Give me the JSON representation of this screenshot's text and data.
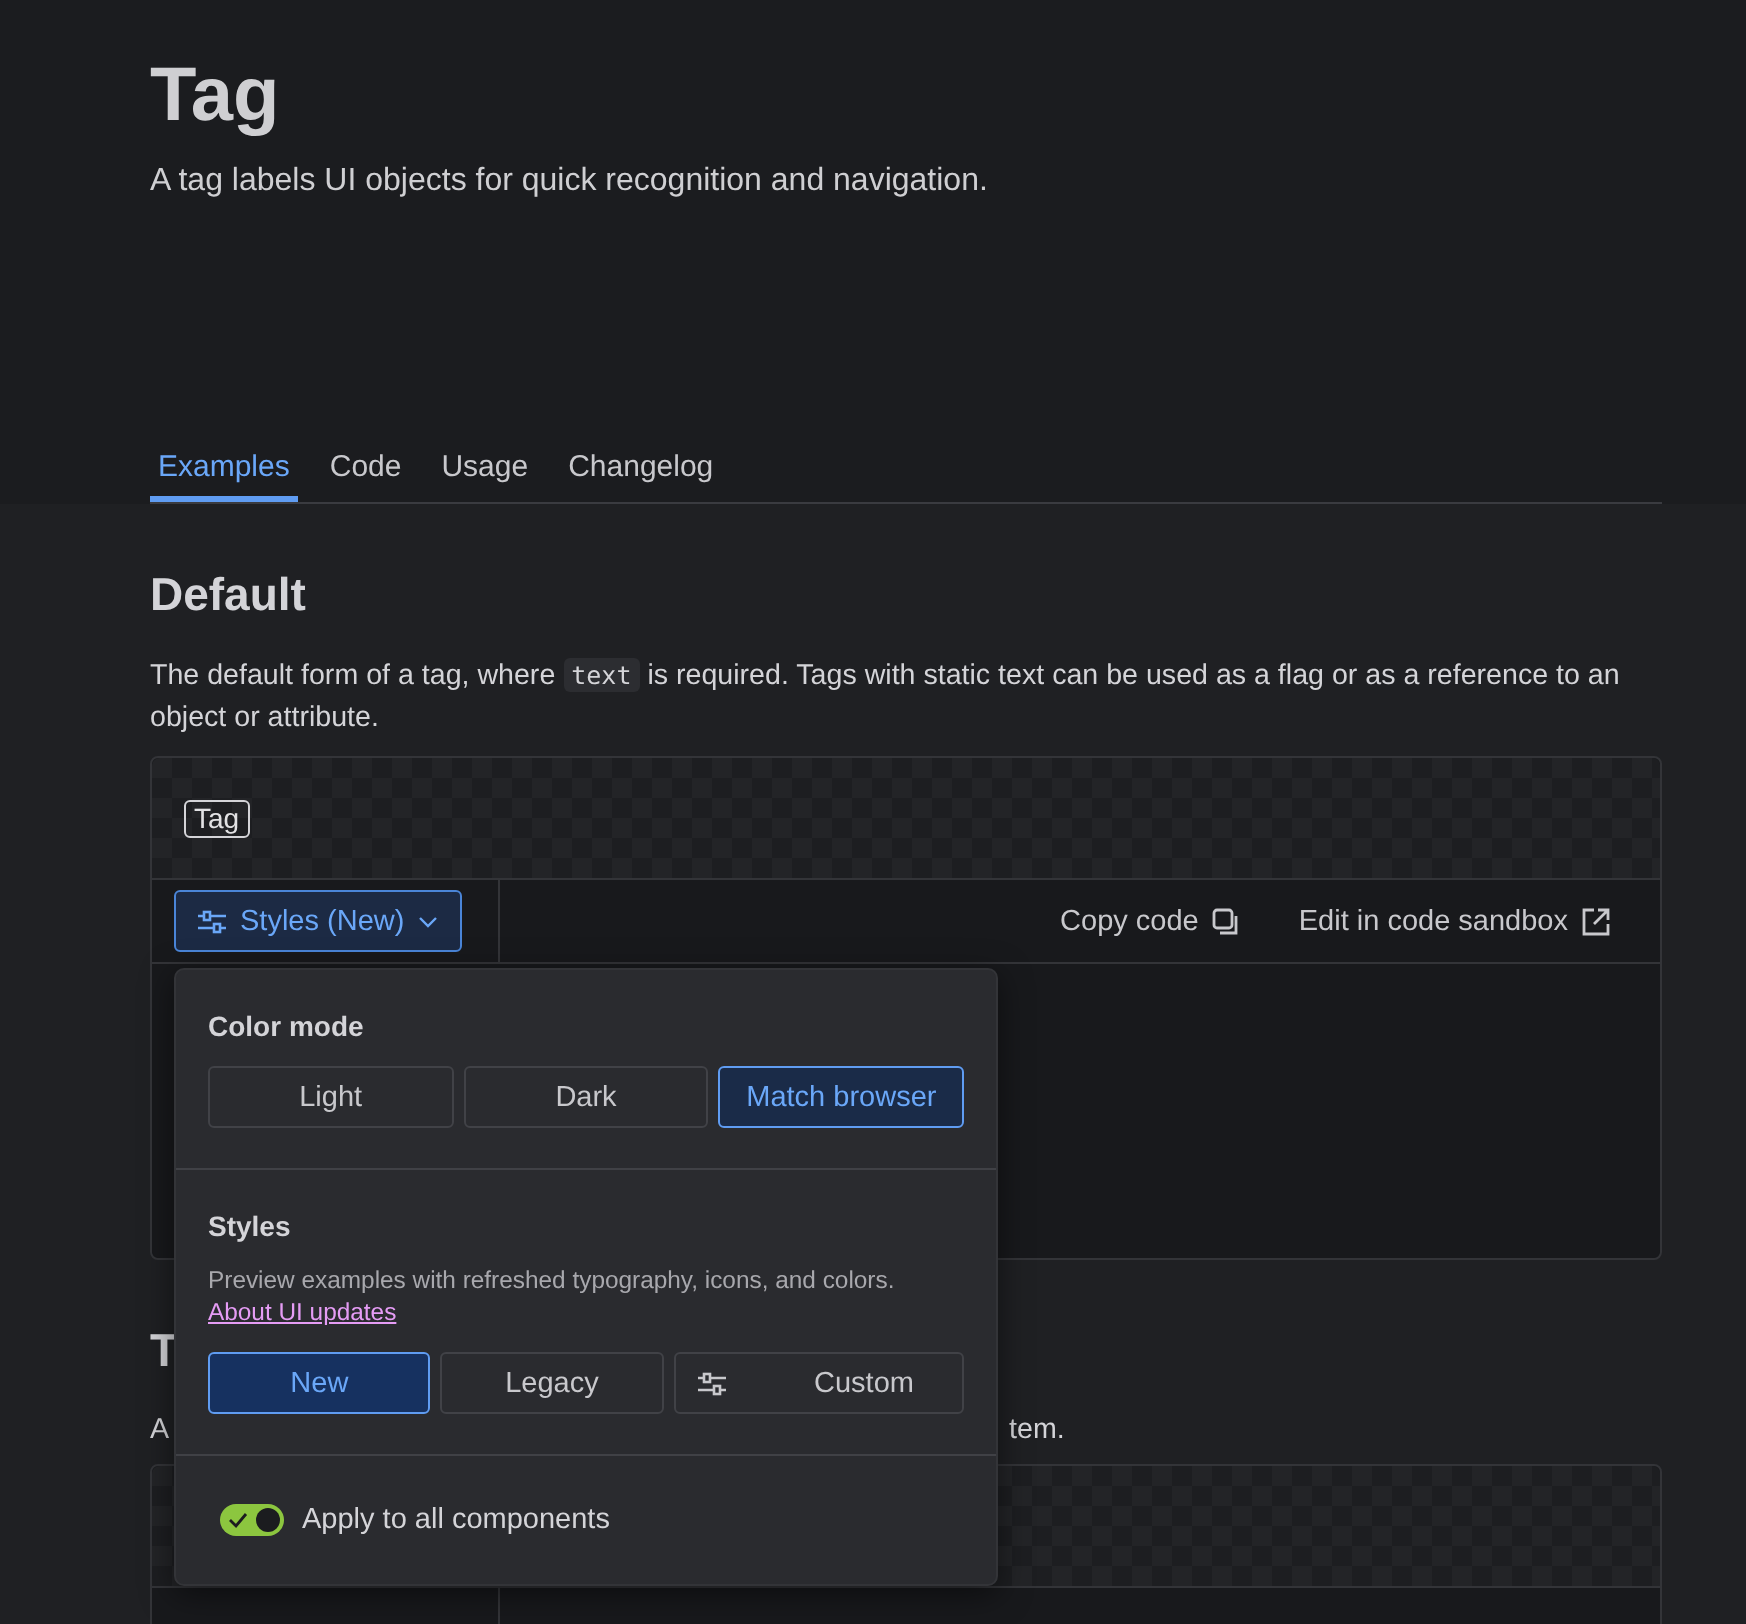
{
  "header": {
    "title": "Tag",
    "subtitle": "A tag labels UI objects for quick recognition and navigation."
  },
  "tabs": [
    {
      "label": "Examples",
      "selected": true
    },
    {
      "label": "Code",
      "selected": false
    },
    {
      "label": "Usage",
      "selected": false
    },
    {
      "label": "Changelog",
      "selected": false
    }
  ],
  "sections": [
    {
      "heading": "Default",
      "description": {
        "before": "The default form of a tag, where ",
        "code": "text",
        "after": " is required. Tags with static text can be used as a flag or as a reference to an object or attribute."
      },
      "example": {
        "tag": "Tag",
        "styles_button": "Styles (New)",
        "copy_code": "Copy code",
        "sandbox": "Edit in code sandbox"
      }
    },
    {
      "heading": "T",
      "description_fragments": [
        "A",
        "tem."
      ]
    }
  ],
  "popover": {
    "color_mode": {
      "title": "Color mode",
      "options": [
        {
          "label": "Light",
          "selected": false
        },
        {
          "label": "Dark",
          "selected": false
        },
        {
          "label": "Match browser",
          "selected": true
        }
      ]
    },
    "styles": {
      "title": "Styles",
      "description": "Preview examples with refreshed typography, icons, and colors.",
      "link": "About UI updates",
      "options": [
        {
          "label": "New",
          "kind": "plain",
          "selected": true
        },
        {
          "label": "Legacy",
          "kind": "plain",
          "selected": false
        },
        {
          "label": "Custom",
          "kind": "icon",
          "selected": false
        }
      ]
    },
    "apply_all": {
      "label": "Apply to all components",
      "on": true
    }
  }
}
